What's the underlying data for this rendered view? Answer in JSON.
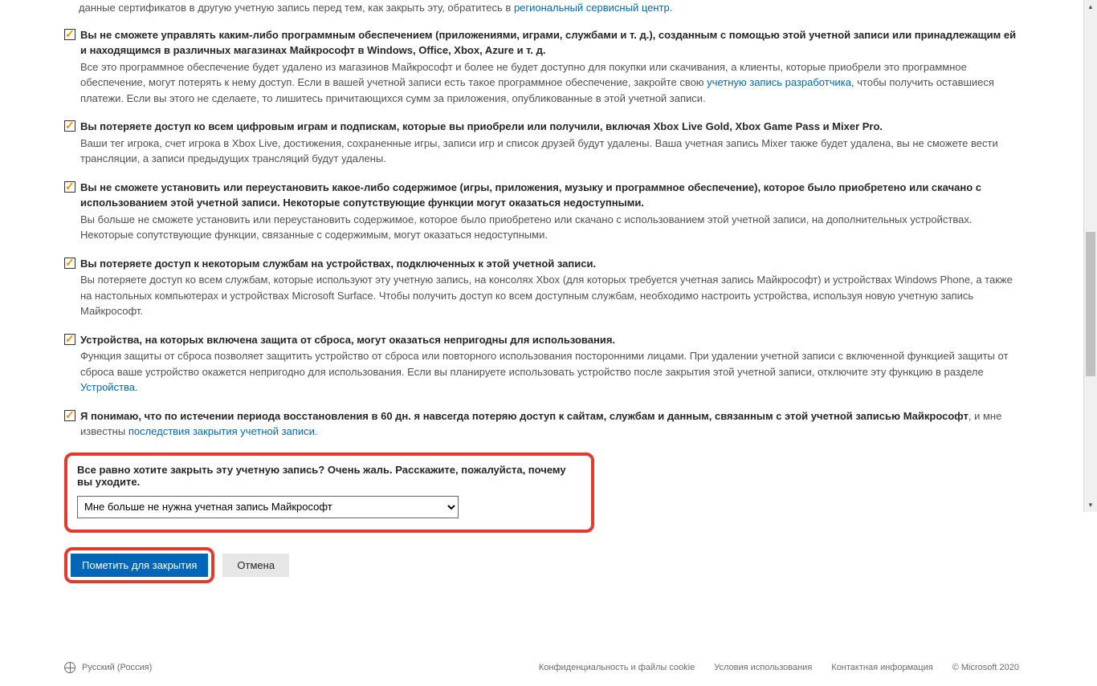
{
  "intro": {
    "text_before": "данные сертификатов в другую учетную запись перед тем, как закрыть эту, обратитесь в ",
    "link": "региональный сервисный центр",
    "text_after": "."
  },
  "items": [
    {
      "title": "Вы не сможете управлять каким-либо программным обеспечением (приложениями, играми, службами и т. д.), созданным с помощью этой учетной записи или принадлежащим ей и находящимся в различных магазинах Майкрософт в Windows, Office, Xbox, Azure и т. д.",
      "desc_before": "Все это программное обеспечение будет удалено из магазинов Майкрософт и более не будет доступно для покупки или скачивания, а клиенты, которые приобрели это программное обеспечение, могут потерять к нему доступ. Если в вашей учетной записи есть такое программное обеспечение, закройте свою ",
      "desc_link": "учетную запись разработчика",
      "desc_after": ", чтобы получить оставшиеся платежи. Если вы этого не сделаете, то лишитесь причитающихся сумм за приложения, опубликованные в этой учетной записи."
    },
    {
      "title": "Вы потеряете доступ ко всем цифровым играм и подпискам, которые вы приобрели или получили, включая Xbox Live Gold, Xbox Game Pass и Mixer Pro.",
      "desc_before": "Ваши тег игрока, счет игрока в Xbox Live, достижения, сохраненные игры, записи игр и список друзей будут удалены. Ваша учетная запись Mixer также будет удалена, вы не сможете вести трансляции, а записи предыдущих трансляций будут удалены.",
      "desc_link": "",
      "desc_after": ""
    },
    {
      "title": "Вы не сможете установить или переустановить какое-либо содержимое (игры, приложения, музыку и программное обеспечение), которое было приобретено или скачано с использованием этой учетной записи. Некоторые сопутствующие функции могут оказаться недоступными.",
      "desc_before": "Вы больше не сможете установить или переустановить содержимое, которое было приобретено или скачано с использованием этой учетной записи, на дополнительных устройствах. Некоторые сопутствующие функции, связанные с содержимым, могут оказаться недоступными.",
      "desc_link": "",
      "desc_after": ""
    },
    {
      "title": "Вы потеряете доступ к некоторым службам на устройствах, подключенных к этой учетной записи.",
      "desc_before": "Вы потеряете доступ ко всем службам, которые используют эту учетную запись, на консолях Xbox (для которых требуется учетная запись Майкрософт) и устройствах Windows Phone, а также на настольных компьютерах и устройствах Microsoft Surface. Чтобы получить доступ ко всем доступным службам, необходимо настроить устройства, используя новую учетную запись Майкрософт.",
      "desc_link": "",
      "desc_after": ""
    },
    {
      "title": "Устройства, на которых включена защита от сброса, могут оказаться непригодны для использования.",
      "desc_before": "Функция защиты от сброса позволяет защитить устройство от сброса или повторного использования посторонними лицами. При удалении учетной записи с включенной функцией защиты от сброса ваше устройство окажется непригодно для использования. Если вы планируете использовать устройство после закрытия этой учетной записи, отключите эту функцию в разделе ",
      "desc_link": "Устройства",
      "desc_after": "."
    },
    {
      "title": "Я понимаю, что по истечении периода восстановления в 60 дн. я навсегда потеряю доступ к сайтам, службам и данным, связанным с этой учетной записью Майкрософт",
      "title_trailing": ", и мне известны ",
      "title_link": "последствия закрытия учетной записи",
      "title_link_after": ".",
      "desc_before": "",
      "desc_link": "",
      "desc_after": ""
    }
  ],
  "reason": {
    "label": "Все равно хотите закрыть эту учетную запись? Очень жаль. Расскажите, пожалуйста, почему вы уходите.",
    "selected": "Мне больше не нужна учетная запись Майкрософт"
  },
  "buttons": {
    "primary": "Пометить для закрытия",
    "secondary": "Отмена"
  },
  "footer": {
    "locale": "Русский (Россия)",
    "links": [
      "Конфиденциальность и файлы cookie",
      "Условия использования",
      "Контактная информация"
    ],
    "copyright": "© Microsoft 2020"
  }
}
